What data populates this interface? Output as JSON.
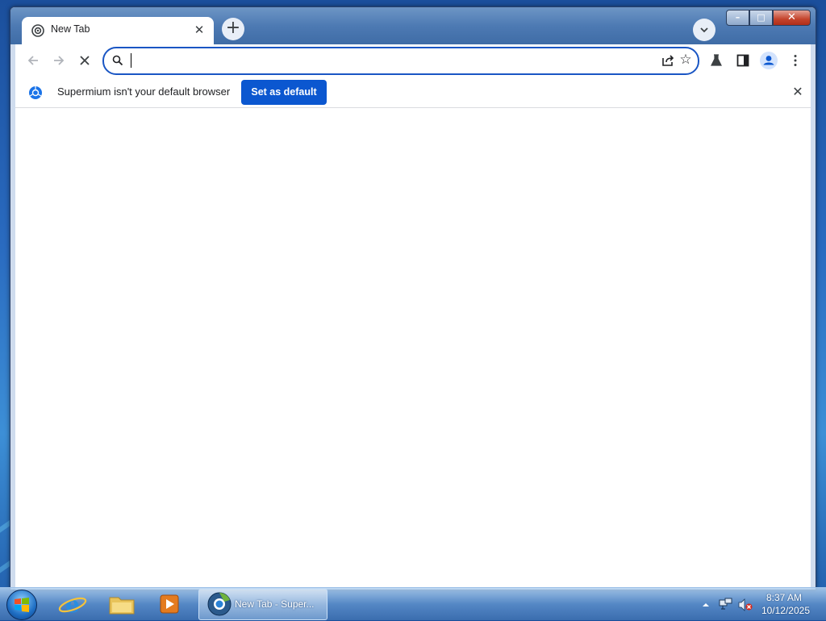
{
  "browser": {
    "tab": {
      "title": "New Tab"
    },
    "new_tab_symbol": "+",
    "window_controls": {
      "minimize": "–",
      "maximize": "□",
      "close": "✕"
    },
    "omnibox": {
      "value": "",
      "placeholder": ""
    },
    "infobar": {
      "message": "Supermium isn't your default browser",
      "button_label": "Set as default"
    }
  },
  "taskbar": {
    "active_window_label": "New Tab - Super...",
    "pinned": [
      "internet-explorer",
      "file-explorer",
      "media-player"
    ],
    "clock": {
      "time": "8:37 AM",
      "date": "10/12/2025"
    }
  },
  "colors": {
    "accent": "#0b57d0",
    "omnibox_border": "#1a56c4",
    "desktop": "#2a6bc0"
  },
  "icons": {
    "back": "arrow-left",
    "forward": "arrow-right",
    "stop": "x",
    "search": "magnifier",
    "share": "share",
    "bookmark": "star",
    "labs": "flask",
    "side_panel": "side-panel",
    "profile": "person"
  }
}
